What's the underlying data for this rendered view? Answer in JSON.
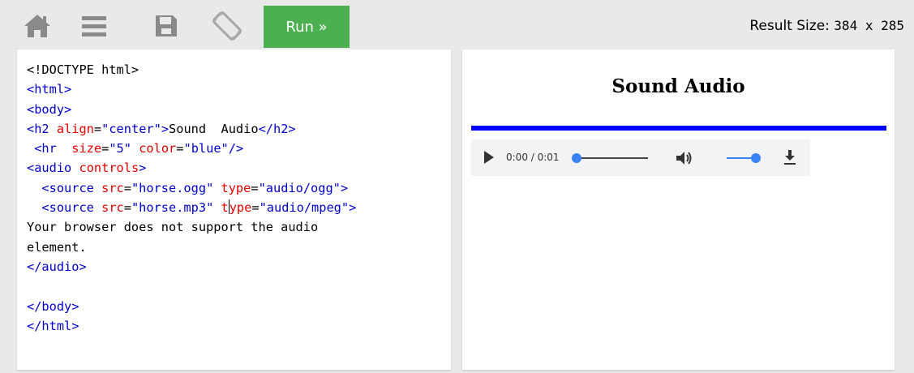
{
  "toolbar": {
    "run_label": "Run »",
    "result_size_label": "Result Size:",
    "result_size_value": "384 x 285"
  },
  "editor": {
    "lines": [
      [
        {
          "c": "plain",
          "t": "<!DOCTYPE html>"
        }
      ],
      [
        {
          "c": "tag",
          "t": "<html>"
        }
      ],
      [
        {
          "c": "tag",
          "t": "<body>"
        }
      ],
      [
        {
          "c": "tag",
          "t": "<h2"
        },
        {
          "c": "plain",
          "t": " "
        },
        {
          "c": "attr",
          "t": "align"
        },
        {
          "c": "plain",
          "t": "="
        },
        {
          "c": "val",
          "t": "\"center\""
        },
        {
          "c": "tag",
          "t": ">"
        },
        {
          "c": "plain",
          "t": "Sound  Audio"
        },
        {
          "c": "tag",
          "t": "</h2>"
        }
      ],
      [
        {
          "c": "plain",
          "t": " "
        },
        {
          "c": "tag",
          "t": "<hr"
        },
        {
          "c": "plain",
          "t": "  "
        },
        {
          "c": "attr",
          "t": "size"
        },
        {
          "c": "plain",
          "t": "="
        },
        {
          "c": "val",
          "t": "\"5\""
        },
        {
          "c": "plain",
          "t": " "
        },
        {
          "c": "attr",
          "t": "color"
        },
        {
          "c": "plain",
          "t": "="
        },
        {
          "c": "val",
          "t": "\"blue\""
        },
        {
          "c": "tag",
          "t": "/>"
        }
      ],
      [
        {
          "c": "tag",
          "t": "<audio"
        },
        {
          "c": "plain",
          "t": " "
        },
        {
          "c": "attr",
          "t": "controls"
        },
        {
          "c": "tag",
          "t": ">"
        }
      ],
      [
        {
          "c": "plain",
          "t": "  "
        },
        {
          "c": "tag",
          "t": "<source"
        },
        {
          "c": "plain",
          "t": " "
        },
        {
          "c": "attr",
          "t": "src"
        },
        {
          "c": "plain",
          "t": "="
        },
        {
          "c": "val",
          "t": "\"horse.ogg\""
        },
        {
          "c": "plain",
          "t": " "
        },
        {
          "c": "attr",
          "t": "type"
        },
        {
          "c": "plain",
          "t": "="
        },
        {
          "c": "val",
          "t": "\"audio/ogg\""
        },
        {
          "c": "tag",
          "t": ">"
        }
      ],
      [
        {
          "c": "plain",
          "t": "  "
        },
        {
          "c": "tag",
          "t": "<source"
        },
        {
          "c": "plain",
          "t": " "
        },
        {
          "c": "attr",
          "t": "src"
        },
        {
          "c": "plain",
          "t": "="
        },
        {
          "c": "val",
          "t": "\"horse.mp3\""
        },
        {
          "c": "plain",
          "t": " "
        },
        {
          "c": "attr",
          "t": "t"
        },
        {
          "c": "caret",
          "t": ""
        },
        {
          "c": "attr",
          "t": "ype"
        },
        {
          "c": "plain",
          "t": "="
        },
        {
          "c": "val",
          "t": "\"audio/mpeg\""
        },
        {
          "c": "tag",
          "t": ">"
        }
      ],
      [
        {
          "c": "plain",
          "t": "Your browser does not support the audio"
        }
      ],
      [
        {
          "c": "plain",
          "t": "element."
        }
      ],
      [
        {
          "c": "tag",
          "t": "</audio>"
        }
      ],
      [
        {
          "c": "plain",
          "t": ""
        }
      ],
      [
        {
          "c": "tag",
          "t": "</body>"
        }
      ],
      [
        {
          "c": "tag",
          "t": "</html>"
        }
      ]
    ]
  },
  "result": {
    "heading": "Sound Audio",
    "hr_color": "#0000ff",
    "player": {
      "time": "0:00 / 0:01",
      "progress_fraction": 0.0,
      "volume_fraction": 1.0,
      "play_icon": "play-icon",
      "volume_icon": "volume-icon",
      "download_icon": "download-icon"
    }
  },
  "colors": {
    "run_button": "#4caf50",
    "tag": "#0000cd",
    "attr": "#e60000",
    "value": "#0000cd",
    "player_accent": "#3b82f6"
  }
}
